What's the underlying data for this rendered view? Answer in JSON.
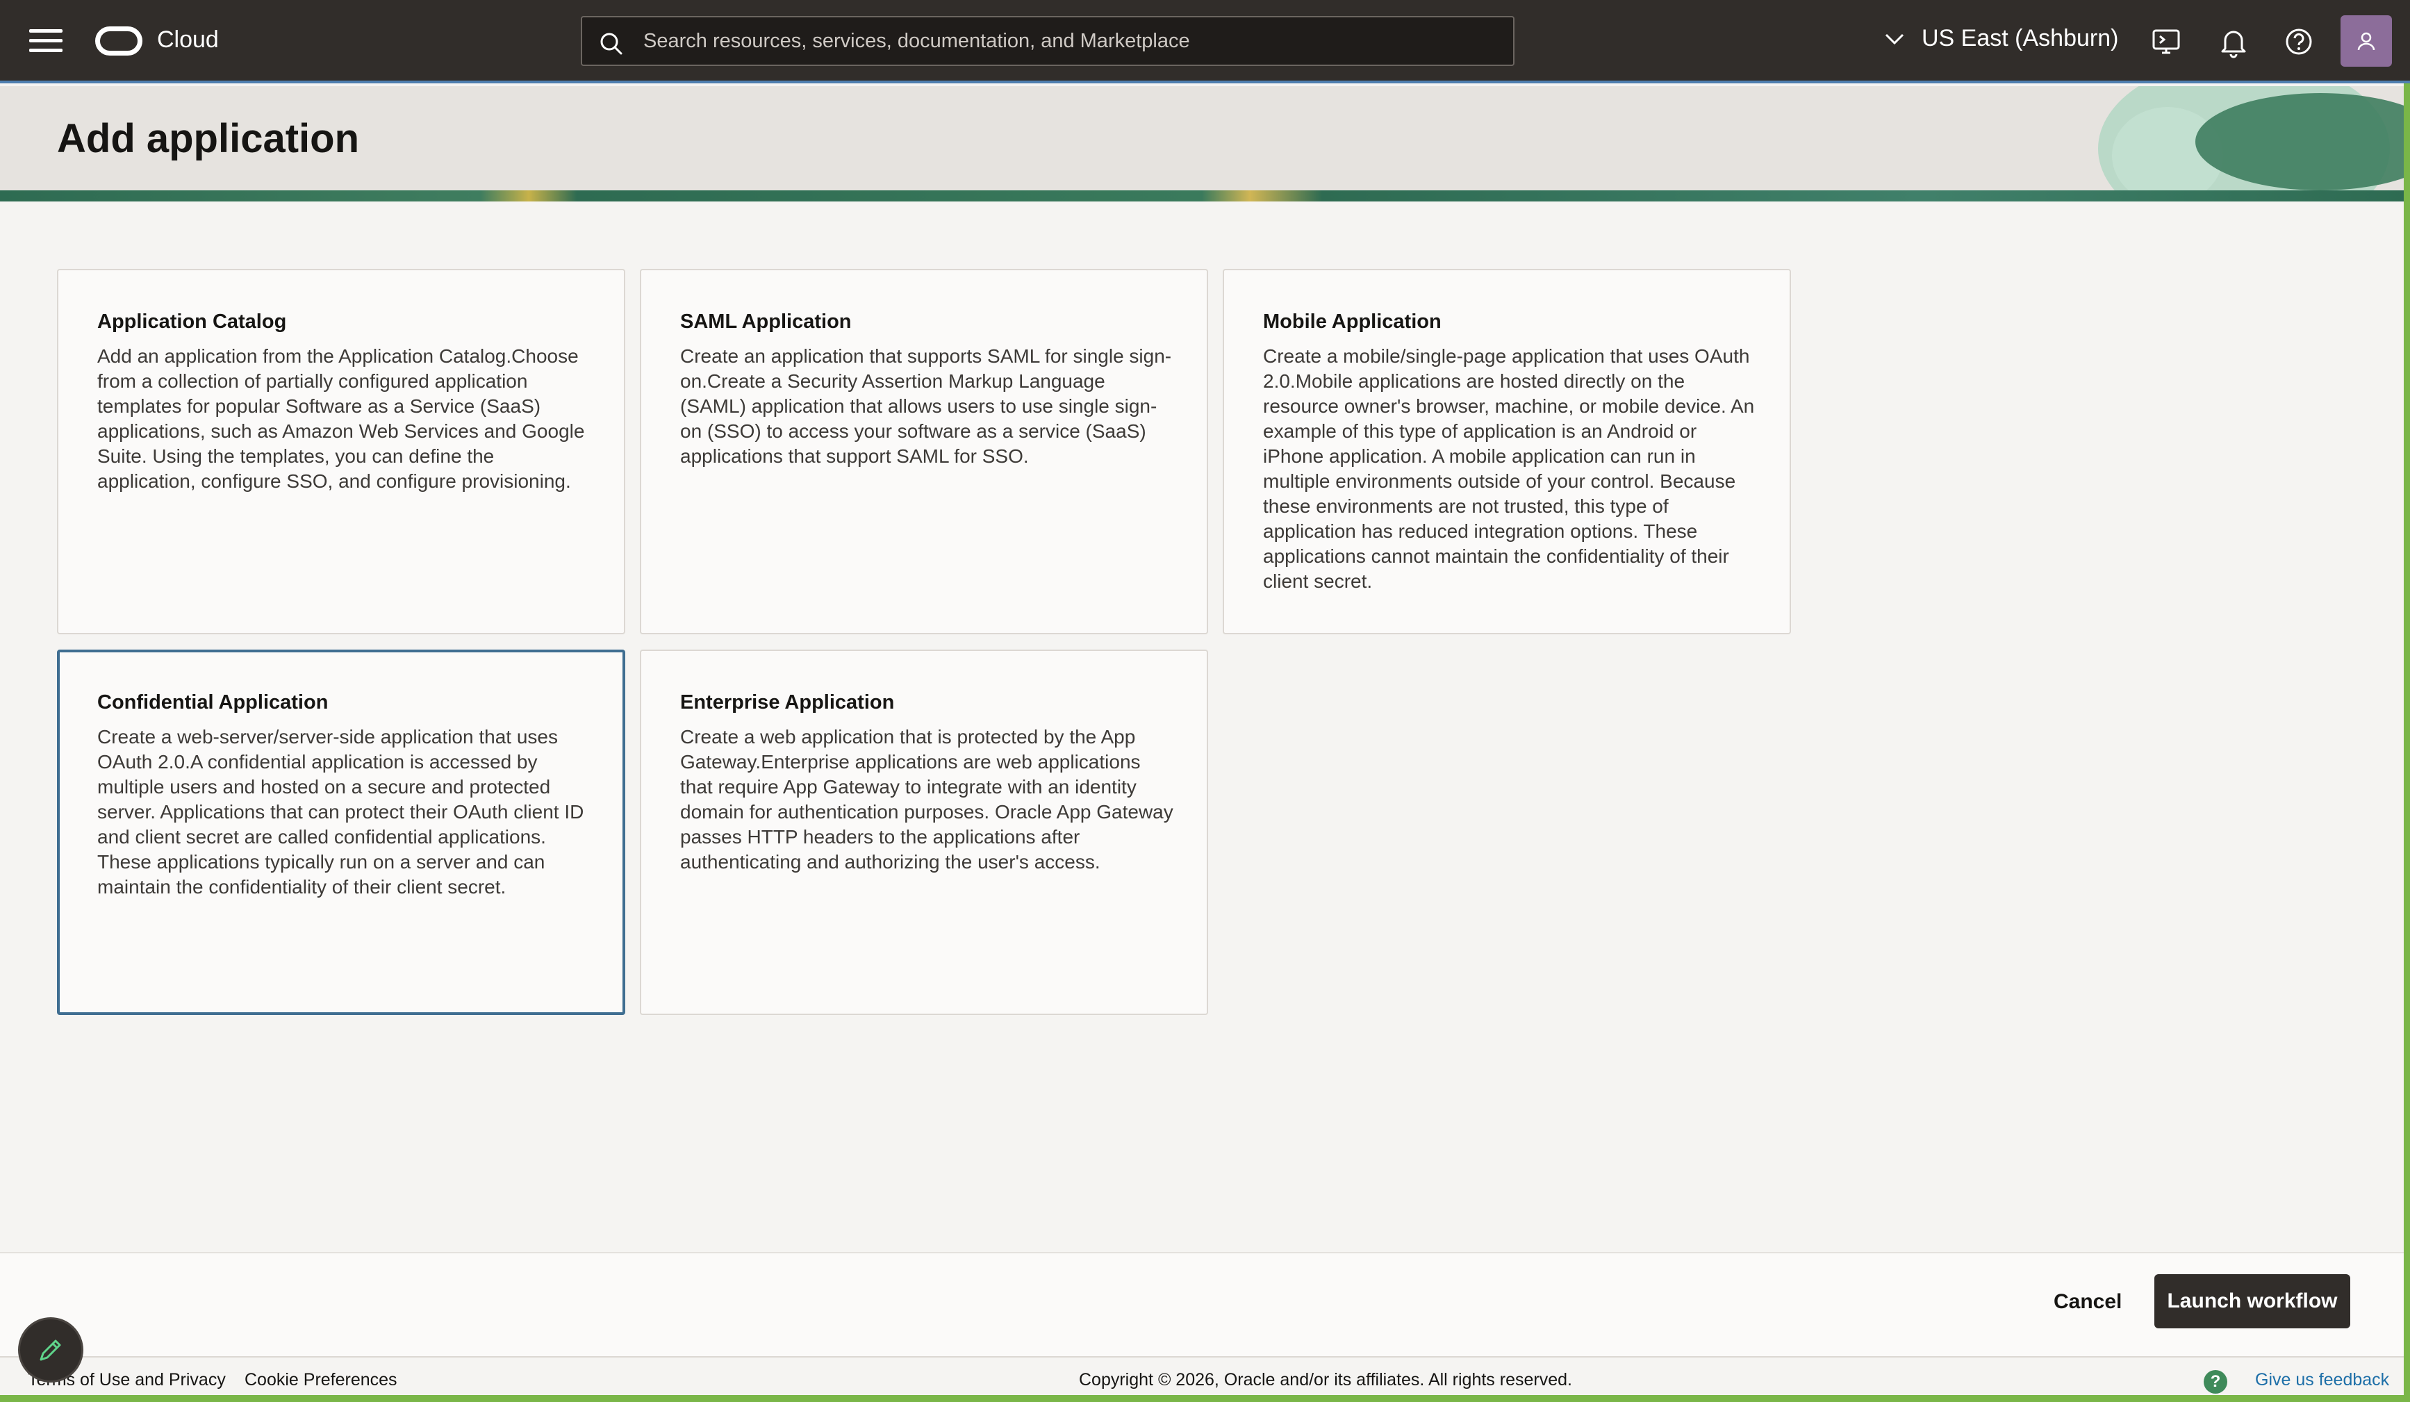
{
  "topbar": {
    "brand": "Cloud",
    "search_placeholder": "Search resources, services, documentation, and Marketplace",
    "region": "US East (Ashburn)"
  },
  "page": {
    "title": "Add application"
  },
  "cards": [
    {
      "title": "Application Catalog",
      "description": "Add an application from the Application Catalog.Choose from a collection of partially configured application templates for popular Software as a Service (SaaS) applications, such as Amazon Web Services and Google Suite. Using the templates, you can define the application, configure SSO, and configure provisioning."
    },
    {
      "title": "SAML Application",
      "description": "Create an application that supports SAML for single sign-on.Create a Security Assertion Markup Language (SAML) application that allows users to use single sign-on (SSO) to access your software as a service (SaaS) applications that support SAML for SSO."
    },
    {
      "title": "Mobile Application",
      "description": "Create a mobile/single-page application that uses OAuth 2.0.Mobile applications are hosted directly on the resource owner's browser, machine, or mobile device. An example of this type of application is an Android or iPhone application. A mobile application can run in multiple environments outside of your control. Because these environments are not trusted, this type of application has reduced integration options. These applications cannot maintain the confidentiality of their client secret."
    },
    {
      "title": "Confidential Application",
      "description": "Create a web-server/server-side application that uses OAuth 2.0.A confidential application is accessed by multiple users and hosted on a secure and protected server. Applications that can protect their OAuth client ID and client secret are called confidential applications. These applications typically run on a server and can maintain the confidentiality of their client secret.",
      "selected": true
    },
    {
      "title": "Enterprise Application",
      "description": "Create a web application that is protected by the App Gateway.Enterprise applications are web applications that require App Gateway to integrate with an identity domain for authentication purposes. Oracle App Gateway passes HTTP headers to the applications after authenticating and authorizing the user's access."
    }
  ],
  "actions": {
    "cancel": "Cancel",
    "launch": "Launch workflow"
  },
  "footer": {
    "terms": "Terms of Use and Privacy",
    "cookies": "Cookie Preferences",
    "copyright": "Copyright © 2026, Oracle and/or its affiliates. All rights reserved.",
    "feedback": "Give us feedback"
  },
  "colors": {
    "topbar_bg": "#312d2a",
    "selected_border": "#3f6e91",
    "primary_button": "#312d2a",
    "link": "#1e6fa8",
    "edge_green": "#7ab648"
  },
  "icons": [
    "hamburger-menu-icon",
    "oracle-logo-icon",
    "search-icon",
    "chevron-down-icon",
    "cloud-shell-icon",
    "bell-icon",
    "help-icon",
    "user-icon",
    "pencil-icon",
    "question-icon"
  ]
}
